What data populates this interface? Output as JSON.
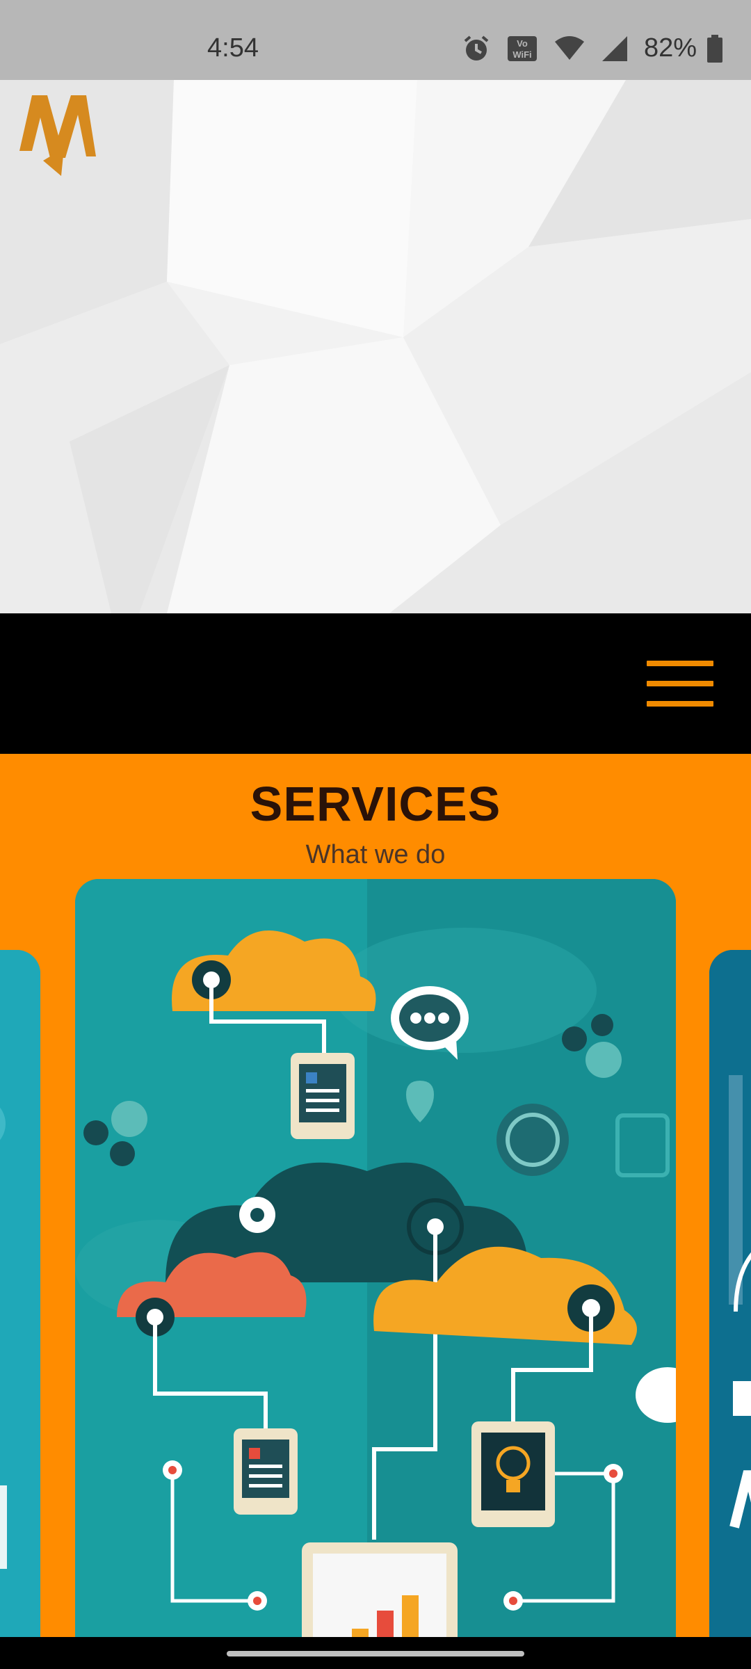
{
  "status_bar": {
    "time": "4:54",
    "battery": "82%",
    "icons": [
      "alarm-icon",
      "vowifi-icon",
      "wifi-icon",
      "signal-icon",
      "battery-icon"
    ]
  },
  "header": {
    "logo": "brand-logo",
    "menu_icon": "hamburger-menu-icon"
  },
  "services": {
    "title": "SERVICES",
    "subtitle": "What we do"
  },
  "colors": {
    "accent": "#f08a00",
    "services_bg": "#ff8c00",
    "card_bg": "#1a9c9e"
  }
}
